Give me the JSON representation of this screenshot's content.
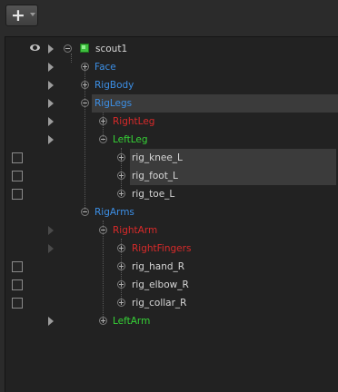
{
  "toolbar": {
    "add_button_symbol": "+",
    "add_button_icon": "plus-icon"
  },
  "colors": {
    "root": "#d7d7d7",
    "group_blue": "#3c8fe6",
    "group_red": "#d82a2a",
    "group_green": "#36d236",
    "joint": "#d7d7d7",
    "selection": "#3b3b3b"
  },
  "tree": {
    "root": "scout1",
    "face": "Face",
    "rigbody": "RigBody",
    "riglegs": "RigLegs",
    "rightleg": "RightLeg",
    "leftleg": "LeftLeg",
    "rig_knee_l": "rig_knee_L",
    "rig_foot_l": "rig_foot_L",
    "rig_toe_l": "rig_toe_L",
    "rigarms": "RigArms",
    "rightarm": "RightArm",
    "rightfingers": "RightFingers",
    "rig_hand_r": "rig_hand_R",
    "rig_elbow_r": "rig_elbow_R",
    "rig_collar_r": "rig_collar_R",
    "leftarm": "LeftArm"
  }
}
